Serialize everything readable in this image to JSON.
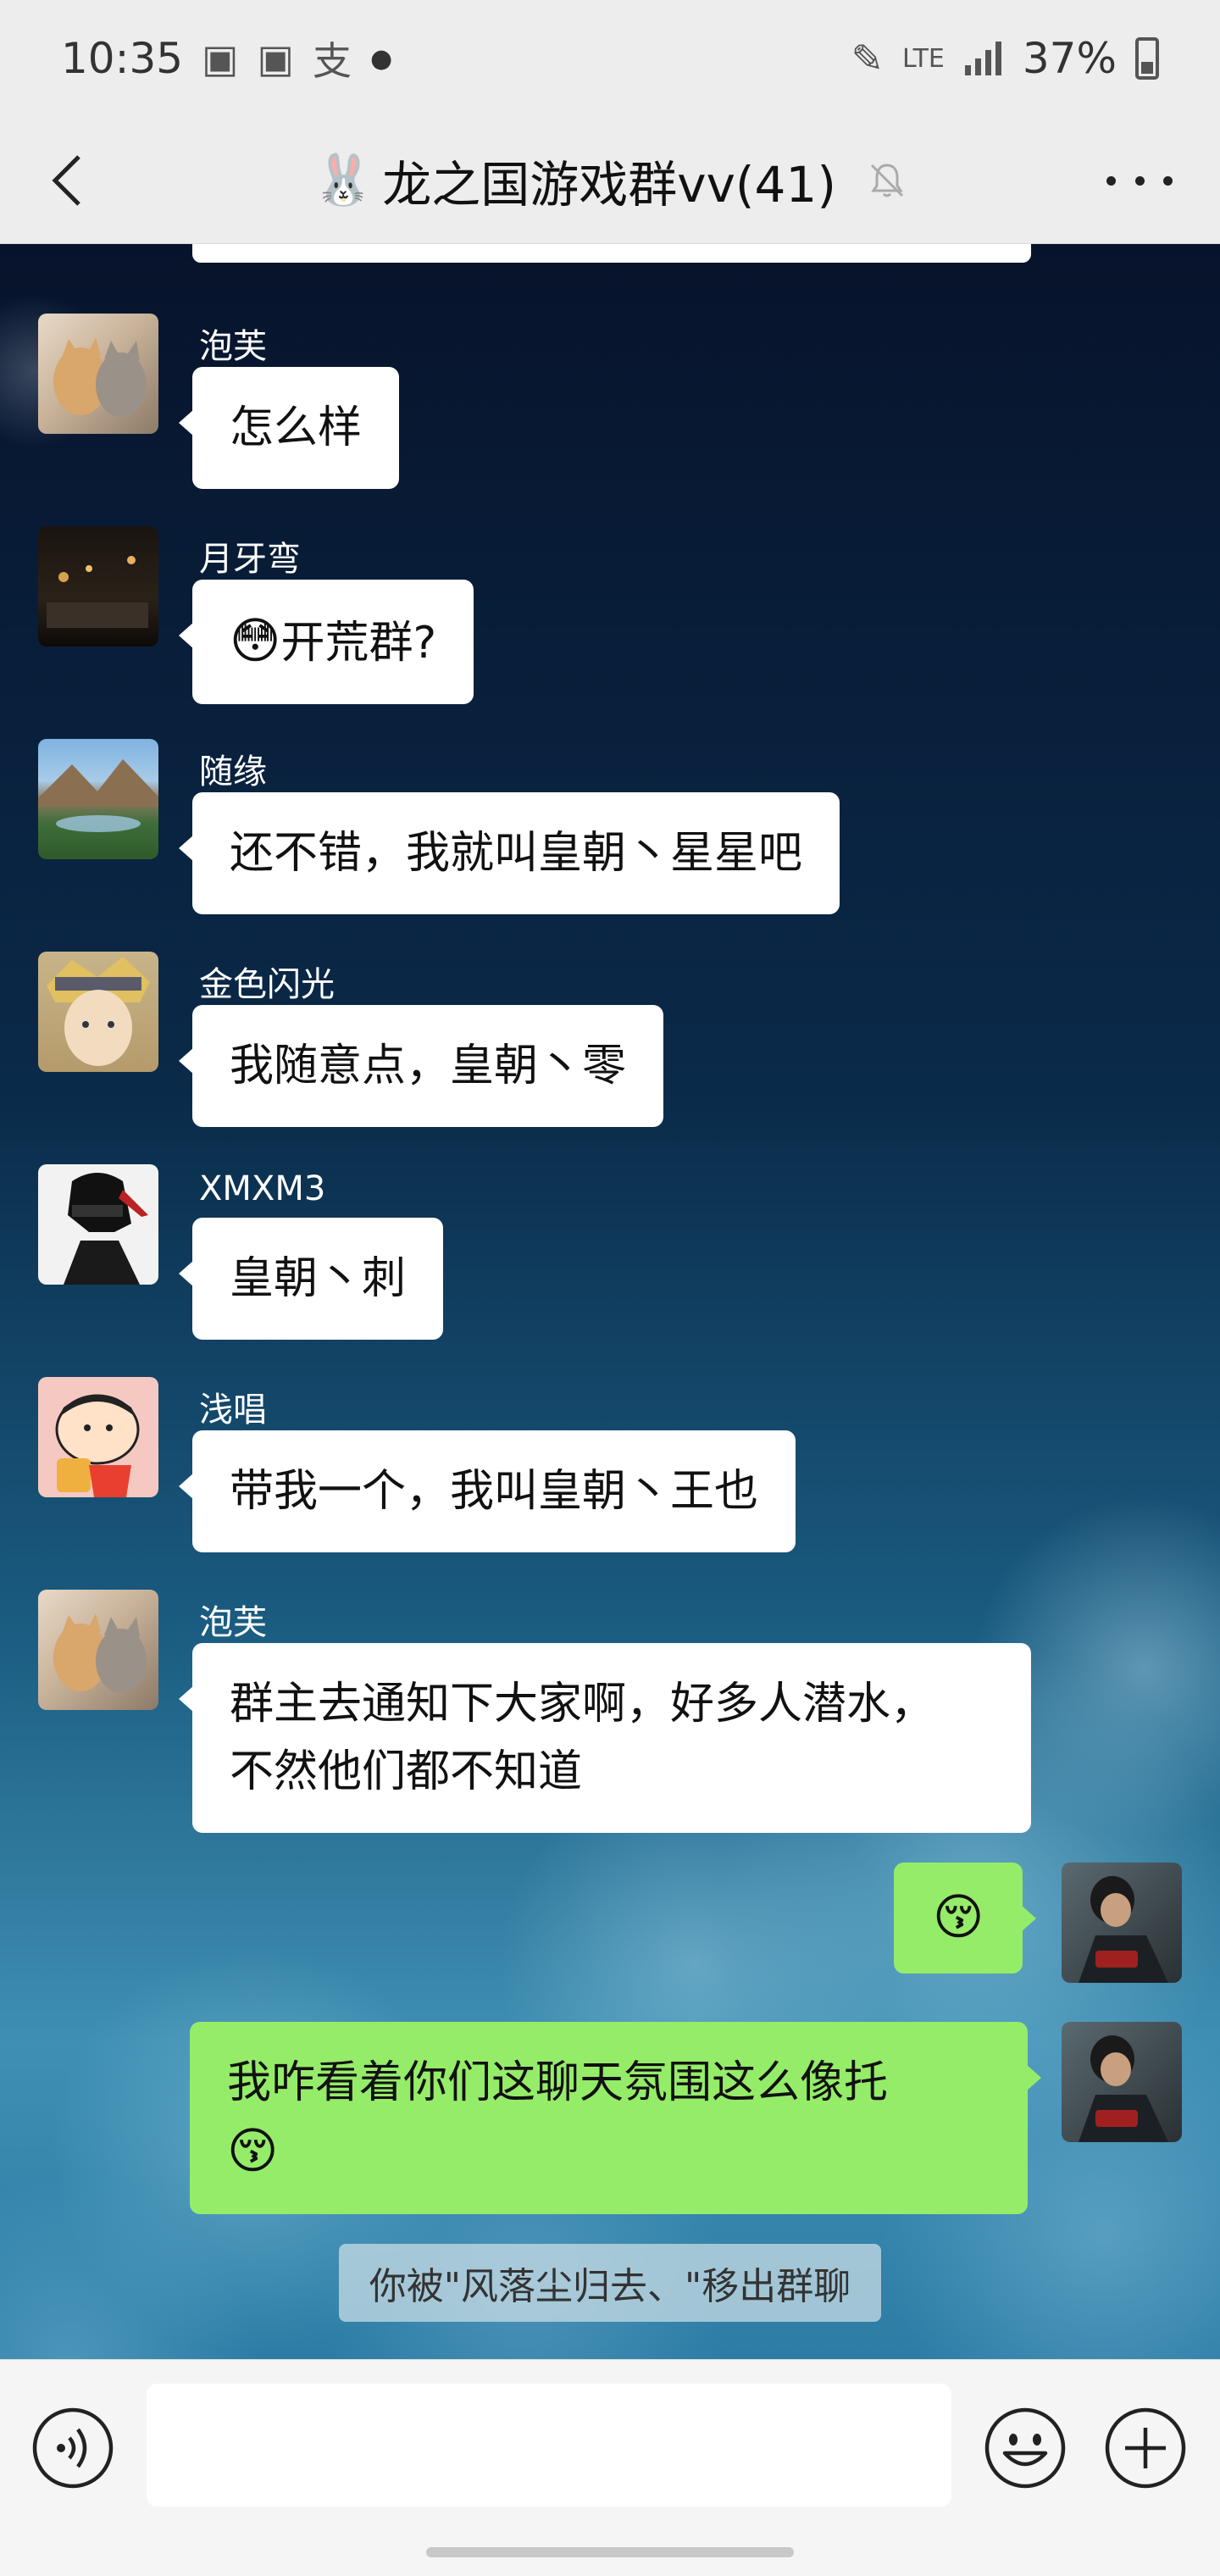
{
  "status_bar": {
    "time": "10:35",
    "notif_icons": [
      "android-icon",
      "android-icon",
      "alipay-icon"
    ],
    "network": "LTE",
    "battery": "37%"
  },
  "header": {
    "title_emoji": "🐰",
    "title": "龙之国游戏群vv(41)"
  },
  "messages": [
    {
      "sender": "泡芙",
      "text": "怎么样"
    },
    {
      "sender": "月牙弯",
      "emoji": "😳",
      "text": "开荒群?"
    },
    {
      "sender": "随缘",
      "text": "还不错，我就叫皇朝丶星星吧"
    },
    {
      "sender": "金色闪光",
      "text": "我随意点，皇朝丶零"
    },
    {
      "sender": "XMXM3",
      "text": "皇朝丶刺"
    },
    {
      "sender": "浅唱",
      "text": "带我一个，我叫皇朝丶王也"
    },
    {
      "sender": "泡芙",
      "text_line1": "群主去通知下大家啊，好多人潜水，",
      "text_line2": "不然他们都不知道"
    }
  ],
  "my_messages": [
    {
      "emoji": "😚"
    },
    {
      "text_line1": "我咋看着你们这聊天氛围这么像托",
      "emoji": "😚"
    }
  ],
  "system_notice": "你被\"风落尘归去、\"移出群聊",
  "input": {
    "placeholder": ""
  },
  "colors": {
    "my_bubble": "#95ec69",
    "their_bubble": "#ffffff",
    "header_bg": "#ededed"
  }
}
